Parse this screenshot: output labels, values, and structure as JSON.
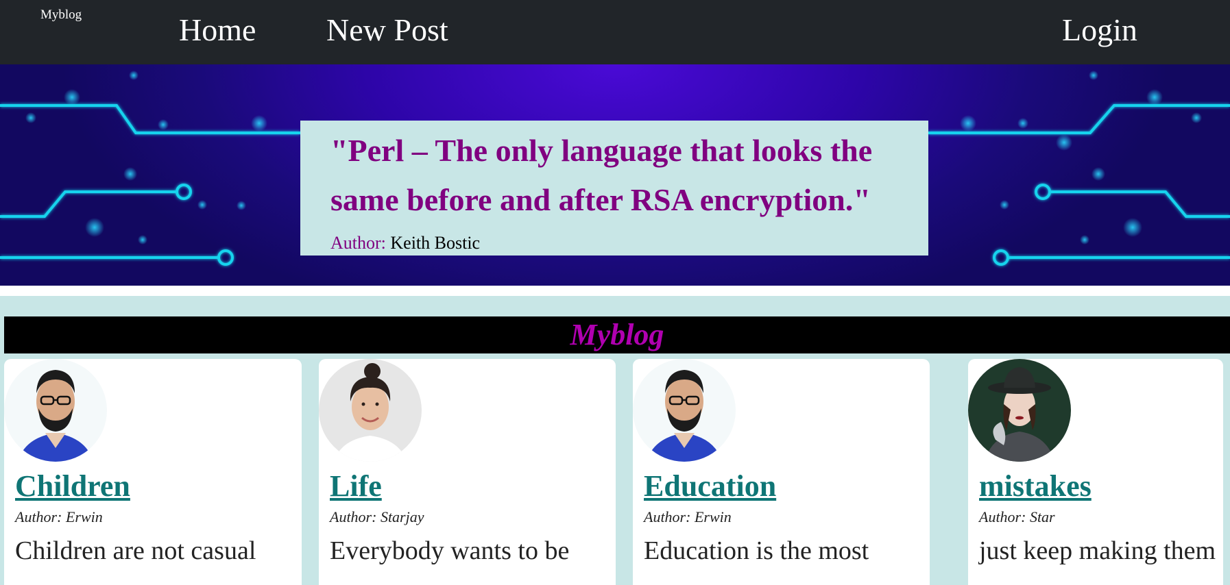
{
  "navbar": {
    "brand": "Myblog",
    "links": [
      {
        "label": "Home"
      },
      {
        "label": "New Post"
      }
    ],
    "login": "Login"
  },
  "hero": {
    "quote": "\"Perl – The only language that looks the same before and after RSA encryption.\"",
    "author_label": "Author:",
    "author_name": "Keith Bostic",
    "colors": {
      "quote": "#800080",
      "box": "#c8e6e6",
      "background": "#2d05a8",
      "circuit": "#19d3ee"
    }
  },
  "main": {
    "banner_title": "Myblog",
    "colors": {
      "banner_bg": "#000000",
      "banner_text": "#b000b0",
      "link": "#0f7575",
      "page_bg": "#c8e6e6"
    },
    "cards": [
      {
        "title": "Children",
        "author": "Author: Erwin",
        "excerpt": "Children are not casual",
        "avatar": "bearded-man-glasses-avatar"
      },
      {
        "title": "Life",
        "author": "Author: Starjay",
        "excerpt": "Everybody wants to be",
        "avatar": "smiling-woman-avatar"
      },
      {
        "title": "Education",
        "author": "Author: Erwin",
        "excerpt": "Education is the most",
        "avatar": "bearded-man-glasses-avatar"
      },
      {
        "title": "mistakes",
        "author": "Author: Star",
        "excerpt": "just keep making them",
        "avatar": "woman-with-hat-avatar"
      }
    ]
  }
}
